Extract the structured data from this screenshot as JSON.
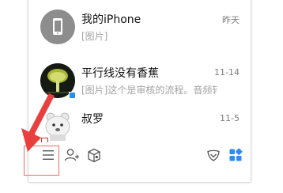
{
  "chats": [
    {
      "name": "我的iPhone",
      "preview": "[图片]",
      "time": "昨天",
      "avatar": "phone-icon"
    },
    {
      "name": "平行线没有香蕉",
      "preview": "[图片]这个是审核的流程。音频转写",
      "time": "11-14",
      "avatar": "user-avatar-dark"
    },
    {
      "name": "叔罗",
      "preview": "",
      "time": "11-5",
      "avatar": "user-avatar-cartoon"
    }
  ],
  "toolbar": {
    "items": [
      "menu-icon",
      "add-contact-icon",
      "cube-icon",
      "shield-icon",
      "app-grid-icon"
    ]
  },
  "colors": {
    "accent_blue": "#2d8cf0",
    "annotation_red": "#e8403f",
    "text_primary": "#111111",
    "text_secondary": "#a3a3a3",
    "text_time": "#7d7d7d"
  }
}
